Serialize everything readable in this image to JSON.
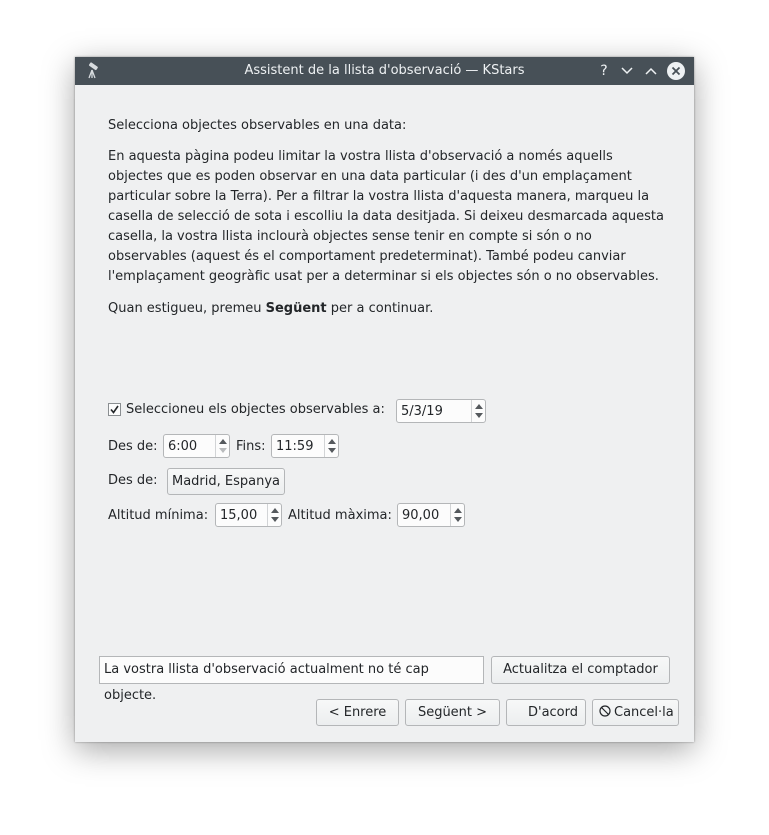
{
  "window": {
    "title": "Assistent de la llista d'observació — KStars",
    "controls": {
      "help": "?",
      "minimize": "⌄",
      "maximize": "⌃",
      "close": "✕"
    }
  },
  "intro": {
    "heading": "Selecciona objectes observables en una data:",
    "body": "En aquesta pàgina podeu limitar la vostra llista d'observació a només aquells objectes que es poden observar en una data particular (i des d'un emplaçament particular sobre la Terra). Per a filtrar la vostra llista d'aquesta manera, marqueu la casella de selecció de sota i escolliu la data desitjada. Si deixeu desmarcada aquesta casella, la vostra llista inclourà objectes sense tenir en compte si són o no observables (aquest és el comportament predeterminat). També podeu canviar l'emplaçament geogràfic usat per a determinar si els objectes són o no observables.",
    "continue_prefix": "Quan estigueu, premeu ",
    "continue_bold": "Següent",
    "continue_suffix": " per a continuar."
  },
  "form": {
    "select_date_label": "Seleccioneu els objectes observables a:",
    "select_date_checked": true,
    "date_value": "5/3/19",
    "from_label": "Des de:",
    "from_time": "6:00",
    "to_label": "Fins:",
    "to_time": "11:59",
    "location_label": "Des de:",
    "location_button": "Madrid, Espanya",
    "min_alt_label": "Altitud mínima:",
    "min_alt_value": "15,00",
    "max_alt_label": "Altitud màxima:",
    "max_alt_value": "90,00"
  },
  "status_text": "La vostra llista d'observació actualment no té cap objecte.",
  "buttons": {
    "update_counter": "Actualitza el comptador",
    "back": "< Enrere",
    "next": "Següent >",
    "ok": "D'acord",
    "cancel": "Cancel·la"
  }
}
